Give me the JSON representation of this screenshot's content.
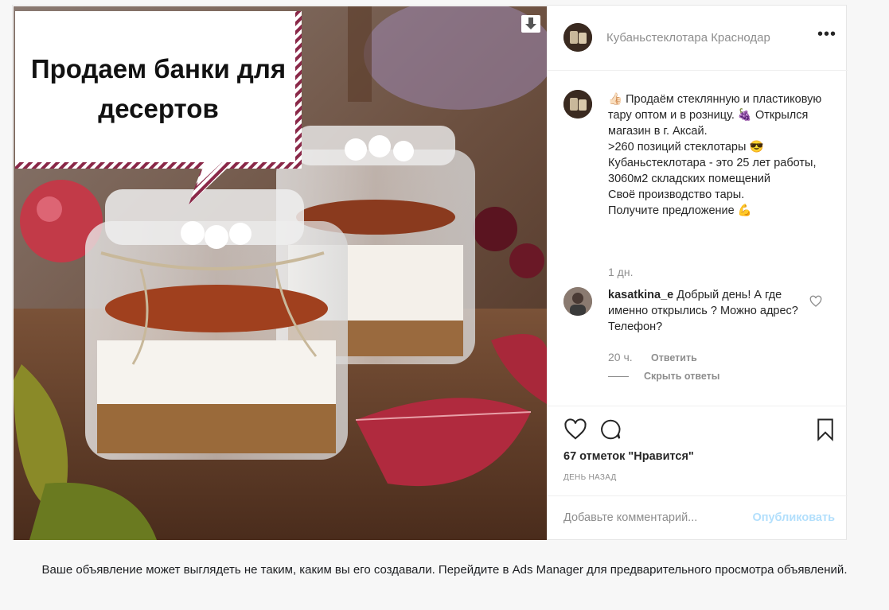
{
  "ad": {
    "banner_text_line1": "Продаем банки для",
    "banner_text_line2": "десертов",
    "account_name": "Кубаньстеклотара Краснодар",
    "more_icon": "•••",
    "caption": "👍🏻 Продаём стеклянную и пластиковую тару оптом и в розницу. 🍇 Открылся магазин в г. Аксай.\n>260 позиций стеклотары 😎\nКубаньстеклотара - это 25 лет работы,\n3060м2 складских помещений\nСвоё производство тары.\nПолучите предложение 💪",
    "caption_age": "1 дн.",
    "comment": {
      "username": "kasatkina_e",
      "text": " Добрый день! А где именно открылись ? Можно адрес? Телефон?",
      "age": "20 ч.",
      "reply_label": "Ответить",
      "hide_replies_label": "Скрыть ответы"
    },
    "likes": "67 отметок \"Нравится\"",
    "timestamp": "ДЕНЬ НАЗАД",
    "comment_placeholder": "Добавьте комментарий...",
    "publish_label": "Опубликовать"
  },
  "footer_note": "Ваше объявление может выглядеть не таким, каким вы его создавали. Перейдите в Ads Manager для предварительного просмотра объявлений.",
  "colors": {
    "publish_disabled": "#b2dffc",
    "muted_text": "#8e8e8e",
    "banner_border": "#8a2848"
  },
  "icons": [
    "download-icon",
    "more-icon",
    "heart-icon",
    "comment-icon",
    "bookmark-icon"
  ]
}
